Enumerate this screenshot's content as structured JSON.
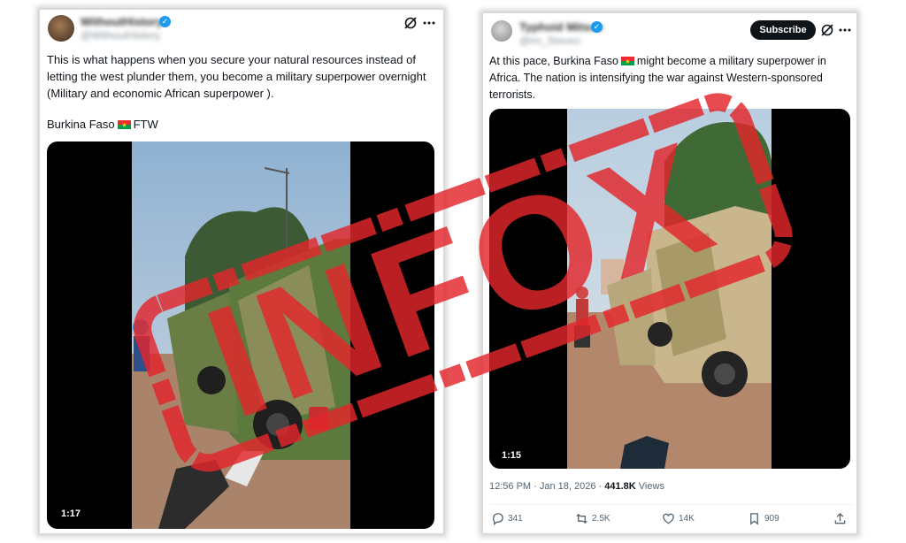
{
  "left_post": {
    "display_name": "WithoutHistory",
    "handle": "@WithoutHistory",
    "text": "This is what happens when you secure your natural resources instead of letting the west plunder them, you become a military superpower overnight (Military and economic African superpower ).",
    "text2_before": "Burkina Faso",
    "text2_after": "FTW",
    "video_duration": "1:17"
  },
  "right_post": {
    "display_name": "Typhoid Mitsue",
    "handle": "@im_Steveo",
    "subscribe_label": "Subscribe",
    "text_before_flag": "At this pace, Burkina Faso",
    "text_after_flag": "might become a military superpower in Africa. The nation is intensifying the war against Western-sponsored terrorists.",
    "video_duration": "1:15",
    "timestamp": "12:56 PM · Jan 18, 2026 ·",
    "views_count": "441.8K",
    "views_label": "Views",
    "actions": {
      "replies": "341",
      "reposts": "2.5K",
      "likes": "14K",
      "bookmarks": "909"
    }
  },
  "stamp_text": "INFOX",
  "colors": {
    "stamp_red": "#e3262b",
    "verified_blue": "#1d9bf0",
    "burkina_red": "#ef2b2d",
    "burkina_green": "#009e49",
    "burkina_star": "#fcd116"
  },
  "icons": [
    "grok-icon",
    "more-icon",
    "reply-icon",
    "repost-icon",
    "like-icon",
    "bookmark-icon",
    "share-icon",
    "verified-icon"
  ]
}
